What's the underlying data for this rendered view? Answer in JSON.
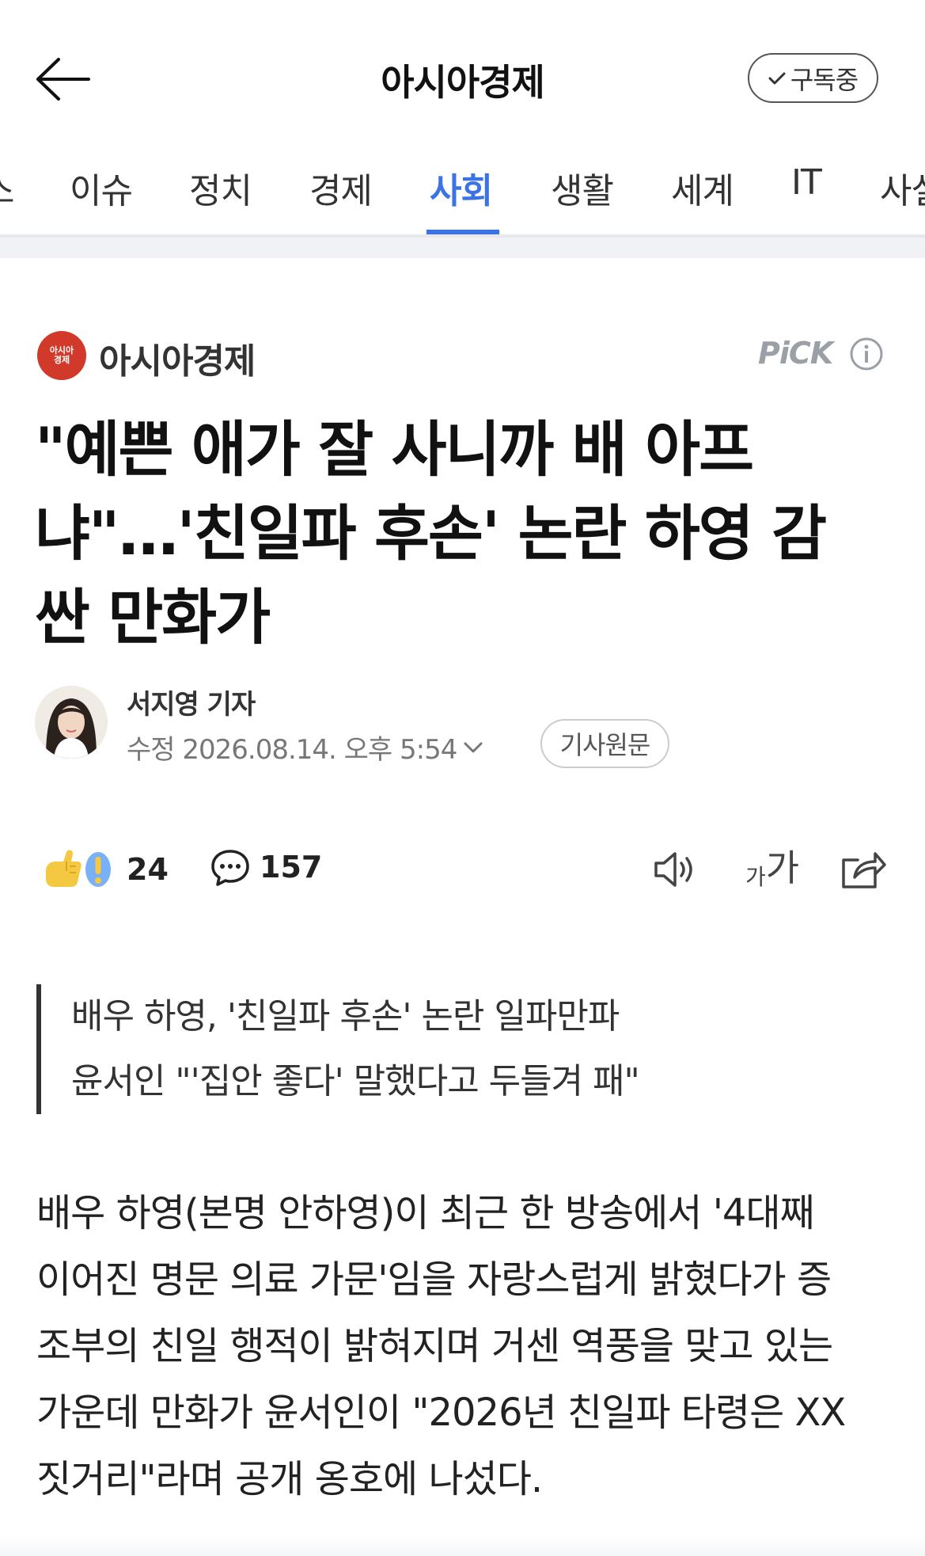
{
  "header": {
    "title": "아시아경제",
    "subscribe_label": "구독중"
  },
  "tabs": [
    {
      "label": "스"
    },
    {
      "label": "이슈"
    },
    {
      "label": "정치"
    },
    {
      "label": "경제"
    },
    {
      "label": "사회",
      "active": true
    },
    {
      "label": "생활"
    },
    {
      "label": "세계"
    },
    {
      "label": "IT"
    },
    {
      "label": "사설"
    }
  ],
  "press": {
    "logo_text_1": "아시아",
    "logo_text_2": "경제",
    "name": "아시아경제",
    "pick_label": "PiCK",
    "brand_color": "#d13a2a"
  },
  "article": {
    "headline_lines": [
      "\"예쁜 애가 잘 사니까 배 아프",
      "냐\"…'친일파 후손' 논란 하영 감",
      "싼 만화가"
    ],
    "reporter": "서지영 기자",
    "date": "수정 2026.08.14. 오후 5:54",
    "original_label": "기사원문",
    "reaction_count": "24",
    "comment_count": "157",
    "font_small": "가",
    "font_big": "가",
    "summary_lines": [
      "배우 하영, '친일파 후손' 논란 일파만파",
      "윤서인 \"'집안 좋다' 말했다고 두들겨 패\""
    ],
    "body_lines": [
      "배우 하영(본명 안하영)이 최근 한 방송에서 '4대째",
      "이어진 명문 의료 가문'임을 자랑스럽게 밝혔다가 증",
      "조부의 친일 행적이 밝혀지며 거센 역풍을 맞고 있는",
      "가운데 만화가 윤서인이 \"2026년 친일파 타령은 XX",
      "짓거리\"라며 공개 옹호에 나섰다."
    ]
  },
  "colors": {
    "accent": "#3b73e6",
    "text": "#111111",
    "muted": "#777777"
  }
}
